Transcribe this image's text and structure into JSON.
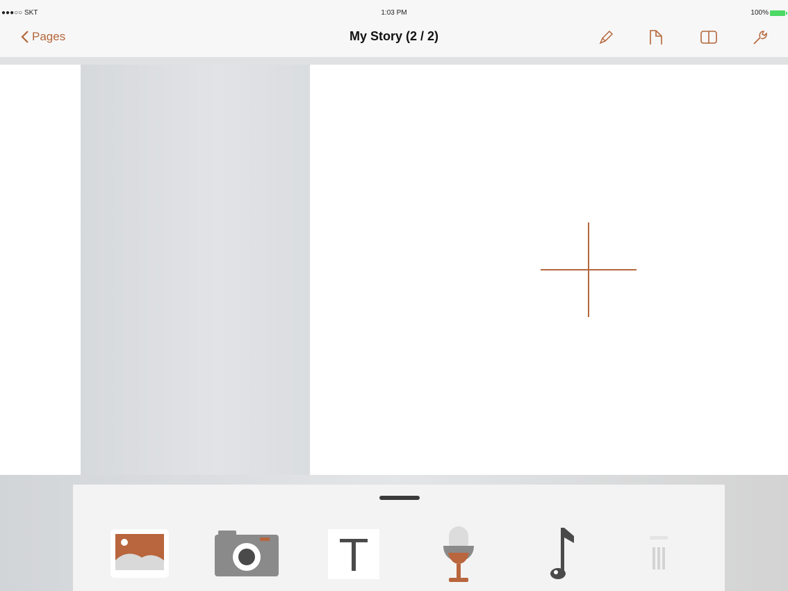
{
  "status_bar": {
    "carrier": "●●●○○ SKT",
    "time": "1:03 PM",
    "battery": "100%"
  },
  "nav": {
    "back_label": "Pages",
    "title": "My Story (2 / 2)",
    "accent_color": "#b4663a",
    "actions": [
      "pen-icon",
      "page-icon",
      "split-view-icon",
      "wrench-icon"
    ]
  },
  "canvas": {
    "add_marker": "plus-icon"
  },
  "toolbar": {
    "handle": "drawer-handle",
    "tools": [
      "photo-library-icon",
      "camera-icon",
      "text-icon",
      "microphone-icon",
      "music-note-icon",
      "trash-icon"
    ]
  }
}
